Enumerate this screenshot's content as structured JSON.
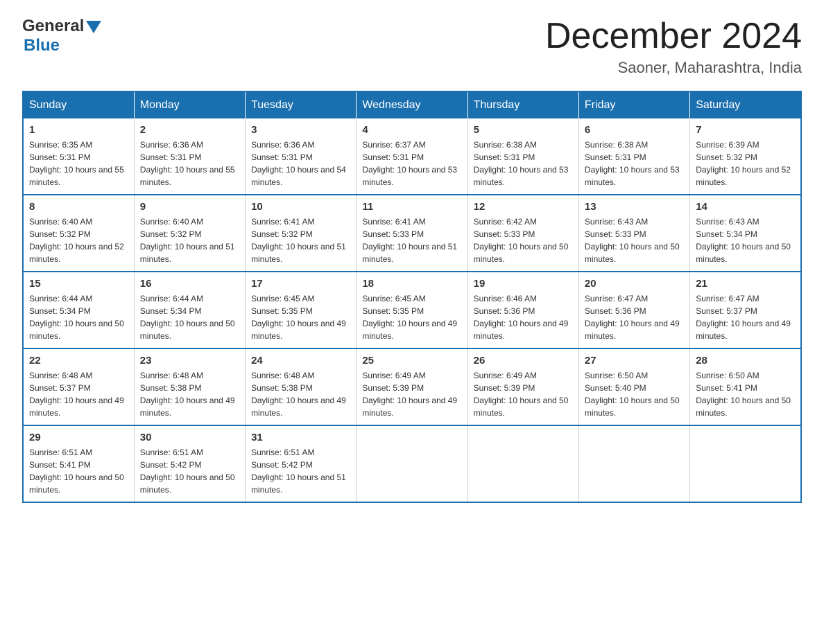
{
  "logo": {
    "text_general": "General",
    "text_blue": "Blue",
    "arrow": "▲"
  },
  "title": "December 2024",
  "subtitle": "Saoner, Maharashtra, India",
  "days_of_week": [
    "Sunday",
    "Monday",
    "Tuesday",
    "Wednesday",
    "Thursday",
    "Friday",
    "Saturday"
  ],
  "weeks": [
    [
      {
        "day": "1",
        "sunrise": "6:35 AM",
        "sunset": "5:31 PM",
        "daylight": "10 hours and 55 minutes."
      },
      {
        "day": "2",
        "sunrise": "6:36 AM",
        "sunset": "5:31 PM",
        "daylight": "10 hours and 55 minutes."
      },
      {
        "day": "3",
        "sunrise": "6:36 AM",
        "sunset": "5:31 PM",
        "daylight": "10 hours and 54 minutes."
      },
      {
        "day": "4",
        "sunrise": "6:37 AM",
        "sunset": "5:31 PM",
        "daylight": "10 hours and 53 minutes."
      },
      {
        "day": "5",
        "sunrise": "6:38 AM",
        "sunset": "5:31 PM",
        "daylight": "10 hours and 53 minutes."
      },
      {
        "day": "6",
        "sunrise": "6:38 AM",
        "sunset": "5:31 PM",
        "daylight": "10 hours and 53 minutes."
      },
      {
        "day": "7",
        "sunrise": "6:39 AM",
        "sunset": "5:32 PM",
        "daylight": "10 hours and 52 minutes."
      }
    ],
    [
      {
        "day": "8",
        "sunrise": "6:40 AM",
        "sunset": "5:32 PM",
        "daylight": "10 hours and 52 minutes."
      },
      {
        "day": "9",
        "sunrise": "6:40 AM",
        "sunset": "5:32 PM",
        "daylight": "10 hours and 51 minutes."
      },
      {
        "day": "10",
        "sunrise": "6:41 AM",
        "sunset": "5:32 PM",
        "daylight": "10 hours and 51 minutes."
      },
      {
        "day": "11",
        "sunrise": "6:41 AM",
        "sunset": "5:33 PM",
        "daylight": "10 hours and 51 minutes."
      },
      {
        "day": "12",
        "sunrise": "6:42 AM",
        "sunset": "5:33 PM",
        "daylight": "10 hours and 50 minutes."
      },
      {
        "day": "13",
        "sunrise": "6:43 AM",
        "sunset": "5:33 PM",
        "daylight": "10 hours and 50 minutes."
      },
      {
        "day": "14",
        "sunrise": "6:43 AM",
        "sunset": "5:34 PM",
        "daylight": "10 hours and 50 minutes."
      }
    ],
    [
      {
        "day": "15",
        "sunrise": "6:44 AM",
        "sunset": "5:34 PM",
        "daylight": "10 hours and 50 minutes."
      },
      {
        "day": "16",
        "sunrise": "6:44 AM",
        "sunset": "5:34 PM",
        "daylight": "10 hours and 50 minutes."
      },
      {
        "day": "17",
        "sunrise": "6:45 AM",
        "sunset": "5:35 PM",
        "daylight": "10 hours and 49 minutes."
      },
      {
        "day": "18",
        "sunrise": "6:45 AM",
        "sunset": "5:35 PM",
        "daylight": "10 hours and 49 minutes."
      },
      {
        "day": "19",
        "sunrise": "6:46 AM",
        "sunset": "5:36 PM",
        "daylight": "10 hours and 49 minutes."
      },
      {
        "day": "20",
        "sunrise": "6:47 AM",
        "sunset": "5:36 PM",
        "daylight": "10 hours and 49 minutes."
      },
      {
        "day": "21",
        "sunrise": "6:47 AM",
        "sunset": "5:37 PM",
        "daylight": "10 hours and 49 minutes."
      }
    ],
    [
      {
        "day": "22",
        "sunrise": "6:48 AM",
        "sunset": "5:37 PM",
        "daylight": "10 hours and 49 minutes."
      },
      {
        "day": "23",
        "sunrise": "6:48 AM",
        "sunset": "5:38 PM",
        "daylight": "10 hours and 49 minutes."
      },
      {
        "day": "24",
        "sunrise": "6:48 AM",
        "sunset": "5:38 PM",
        "daylight": "10 hours and 49 minutes."
      },
      {
        "day": "25",
        "sunrise": "6:49 AM",
        "sunset": "5:39 PM",
        "daylight": "10 hours and 49 minutes."
      },
      {
        "day": "26",
        "sunrise": "6:49 AM",
        "sunset": "5:39 PM",
        "daylight": "10 hours and 50 minutes."
      },
      {
        "day": "27",
        "sunrise": "6:50 AM",
        "sunset": "5:40 PM",
        "daylight": "10 hours and 50 minutes."
      },
      {
        "day": "28",
        "sunrise": "6:50 AM",
        "sunset": "5:41 PM",
        "daylight": "10 hours and 50 minutes."
      }
    ],
    [
      {
        "day": "29",
        "sunrise": "6:51 AM",
        "sunset": "5:41 PM",
        "daylight": "10 hours and 50 minutes."
      },
      {
        "day": "30",
        "sunrise": "6:51 AM",
        "sunset": "5:42 PM",
        "daylight": "10 hours and 50 minutes."
      },
      {
        "day": "31",
        "sunrise": "6:51 AM",
        "sunset": "5:42 PM",
        "daylight": "10 hours and 51 minutes."
      },
      null,
      null,
      null,
      null
    ]
  ]
}
